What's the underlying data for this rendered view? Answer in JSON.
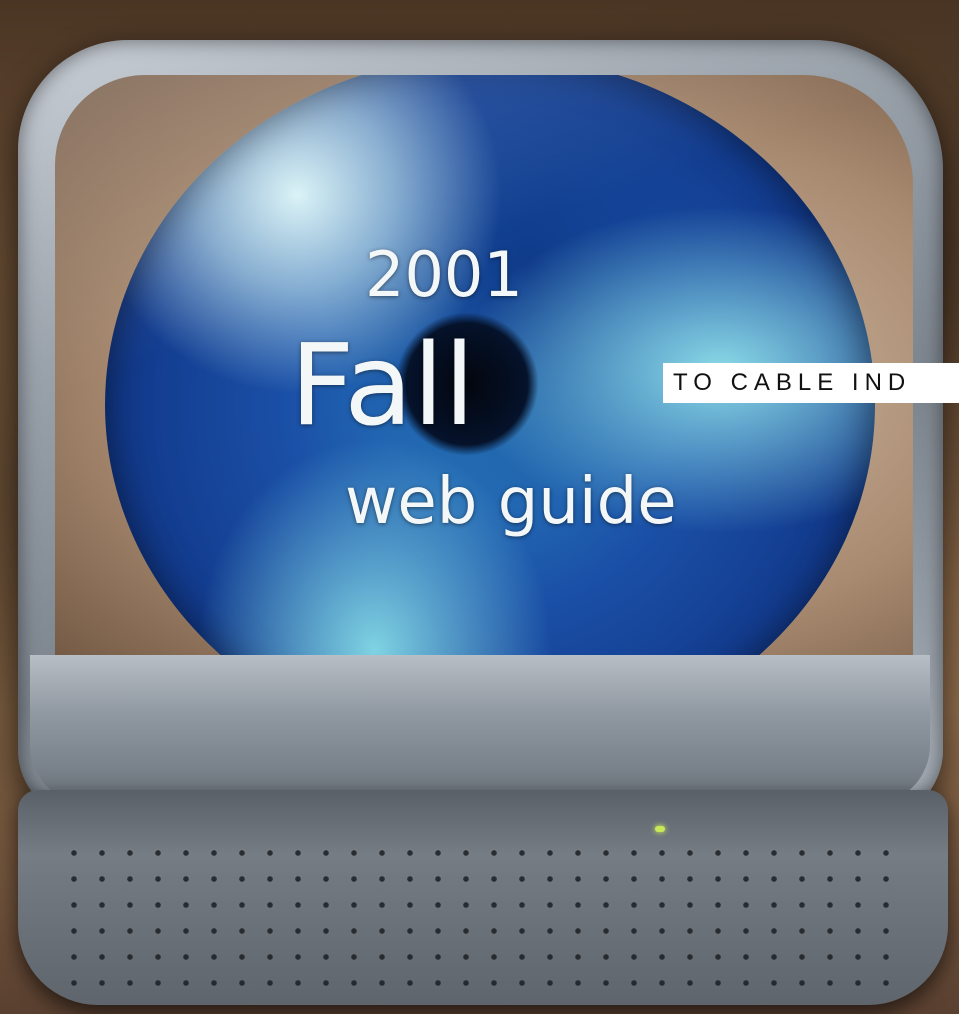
{
  "cover": {
    "year": "2001",
    "season": "Fall",
    "subtitle": "web guide",
    "tagline": "TO CABLE IND"
  },
  "colors": {
    "title_text": "#f4f7f8",
    "iris_blue": "#1a4fa6",
    "tv_silver": "#9aa2ab"
  },
  "icons": [
    "tv-monitor-illustration",
    "eye-globe-image",
    "speaker-grille",
    "power-led"
  ]
}
